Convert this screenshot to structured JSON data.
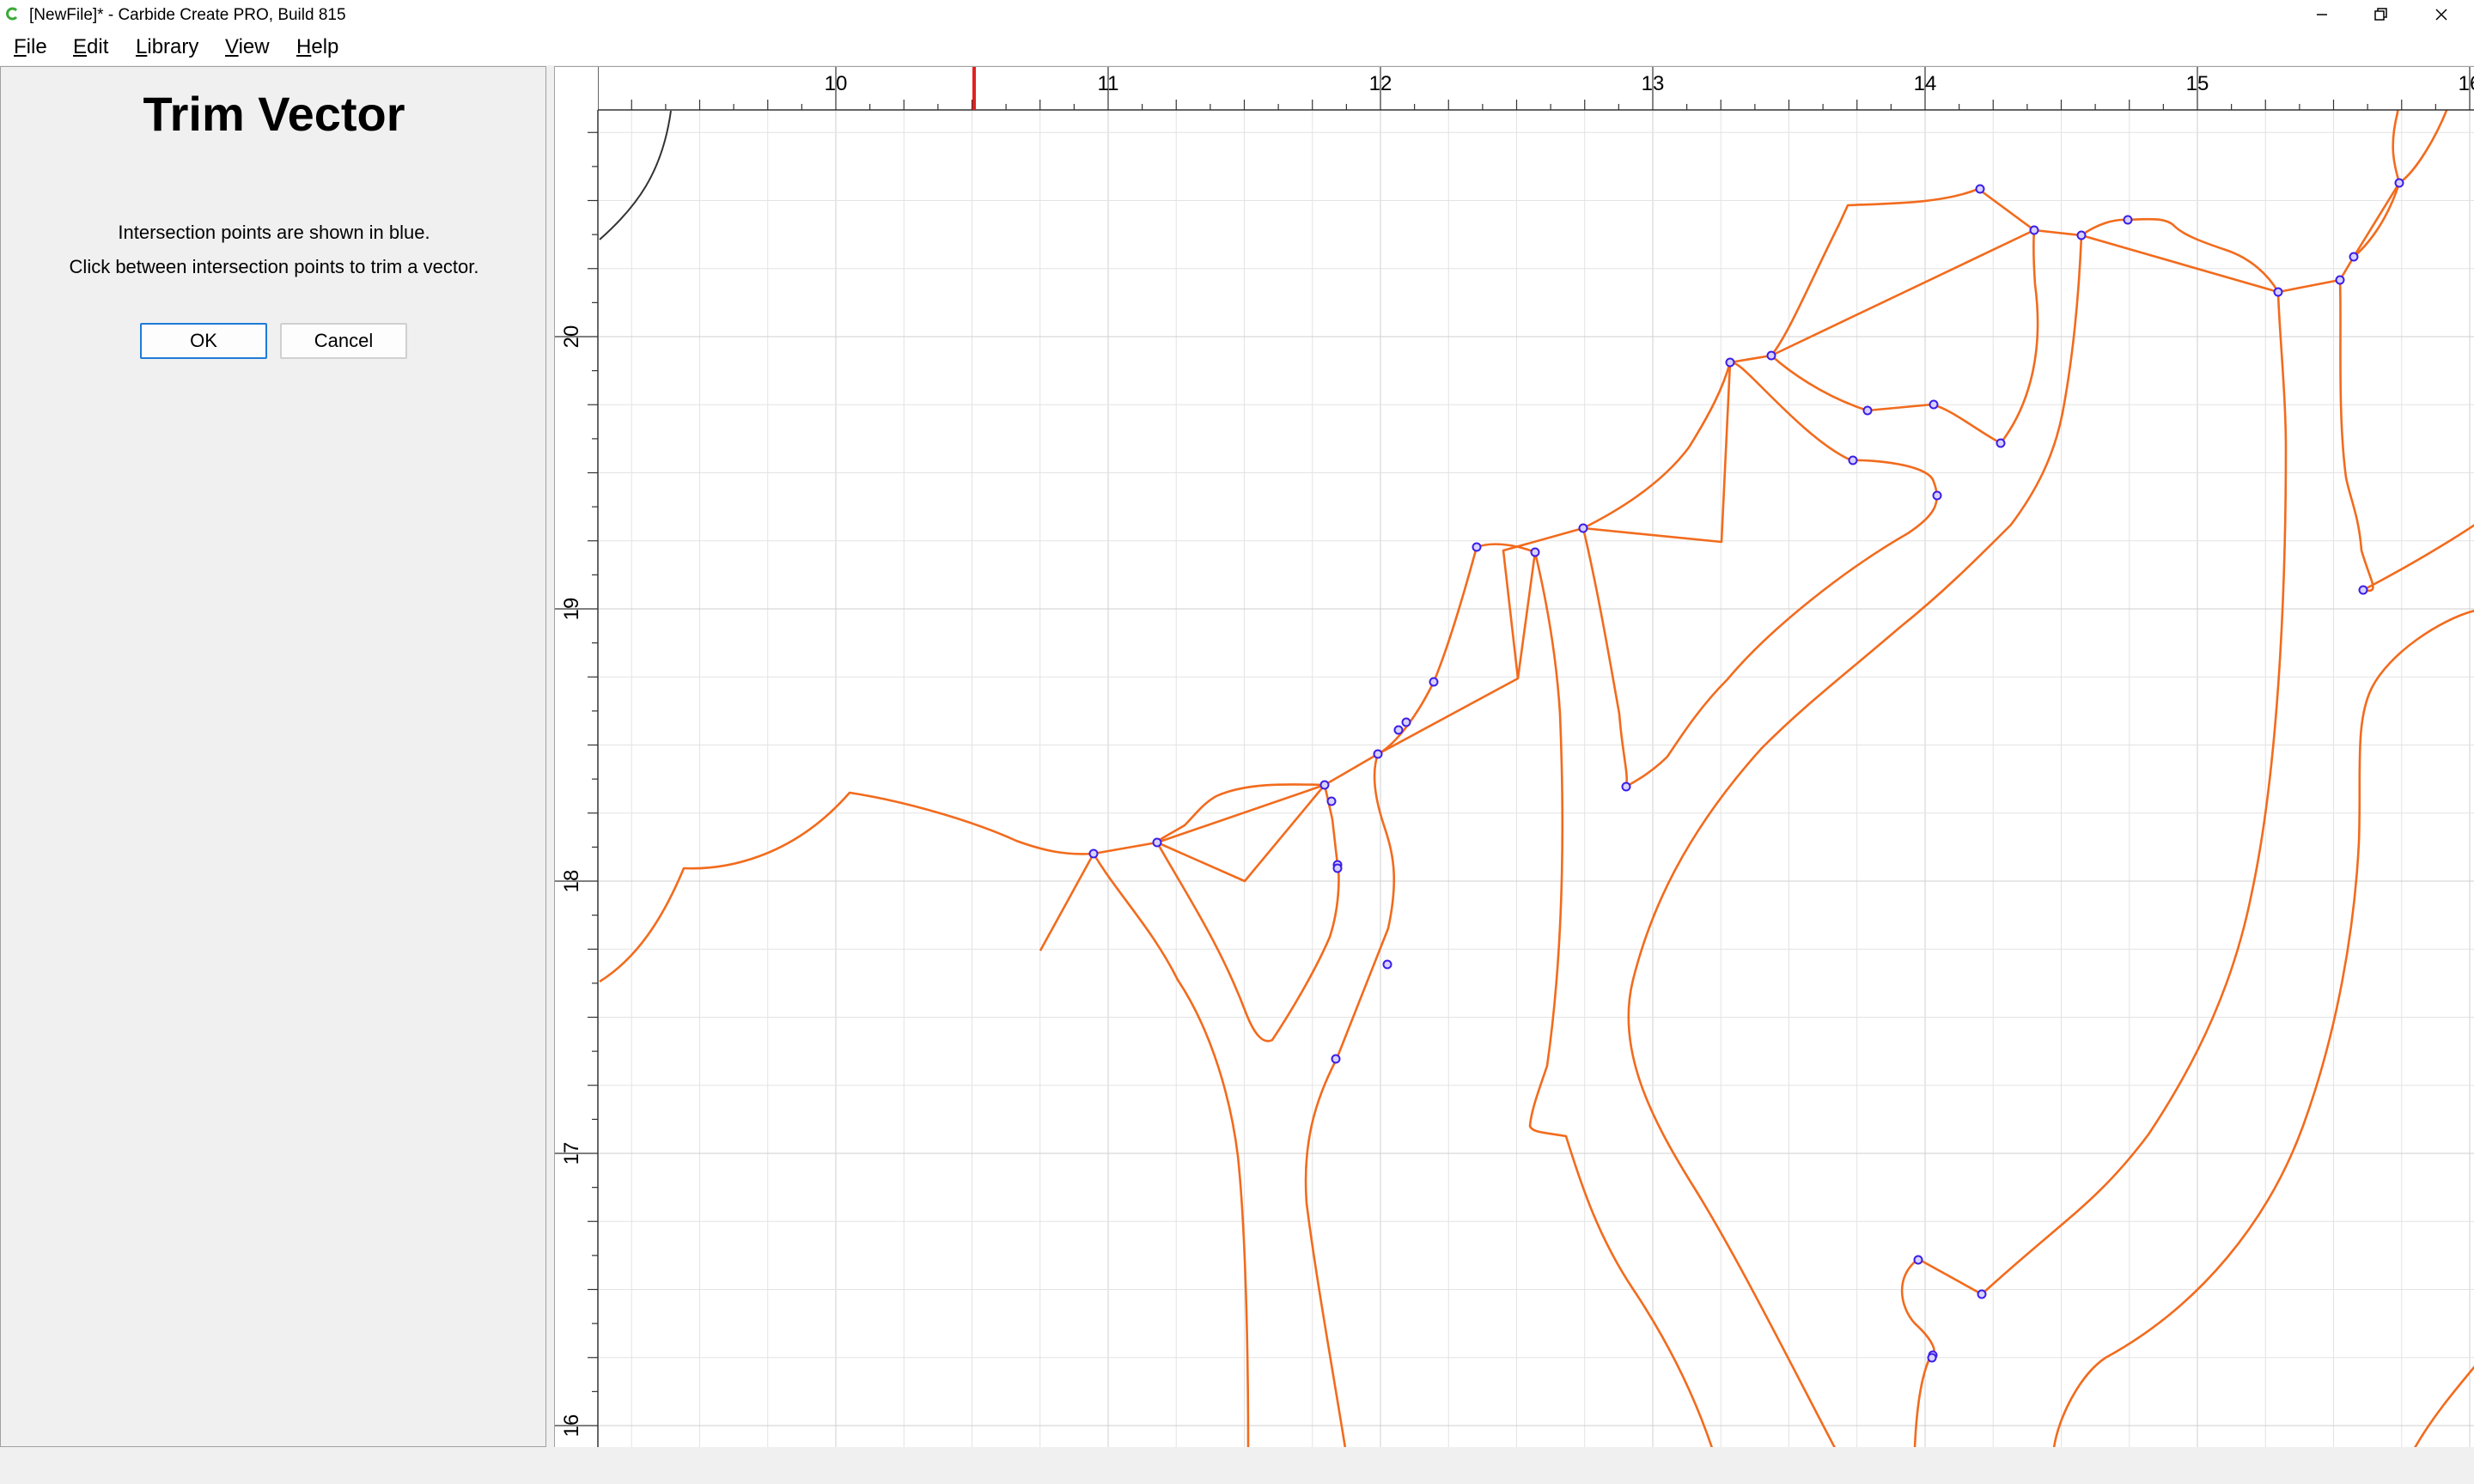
{
  "window": {
    "title": "[NewFile]* - Carbide Create PRO, Build 815",
    "minimize_symbol": "—",
    "restore_symbol": "❐",
    "close_symbol": "✕"
  },
  "menu": {
    "items": [
      "File",
      "Edit",
      "Library",
      "View",
      "Help"
    ]
  },
  "panel": {
    "title": "Trim Vector",
    "line1": "Intersection points are shown in blue.",
    "line2": "Click between intersection points to trim a vector.",
    "ok_label": "OK",
    "cancel_label": "Cancel"
  },
  "canvas": {
    "ruler_x_labels": [
      "10",
      "11",
      "12",
      "13",
      "14",
      "15",
      "16"
    ],
    "ruler_y_labels": [
      "20",
      "19",
      "18",
      "17",
      "16"
    ],
    "vector_color": "#f26b1d",
    "intersection_color": "#3b1ee6",
    "marker_color": "#e32020"
  }
}
